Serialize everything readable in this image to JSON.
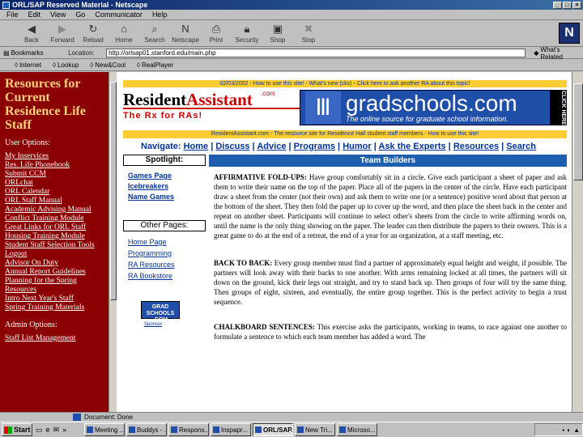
{
  "window": {
    "title": "ORL/SAP Reserved Material - Netscape",
    "controls": [
      "_",
      "□",
      "×"
    ]
  },
  "menu": [
    "File",
    "Edit",
    "View",
    "Go",
    "Communicator",
    "Help"
  ],
  "toolbar": [
    {
      "label": "Back",
      "icon": "back-arrow-icon"
    },
    {
      "label": "Forward",
      "icon": "forward-arrow-icon"
    },
    {
      "label": "Reload",
      "icon": "reload-icon"
    },
    {
      "label": "Home",
      "icon": "home-icon"
    },
    {
      "label": "Search",
      "icon": "search-icon"
    },
    {
      "label": "Netscape",
      "icon": "netscape-icon"
    },
    {
      "label": "Print",
      "icon": "print-icon"
    },
    {
      "label": "Security",
      "icon": "lock-icon"
    },
    {
      "label": "Shop",
      "icon": "shop-icon"
    },
    {
      "label": "Stop",
      "icon": "stop-icon"
    }
  ],
  "location": {
    "bookmarks_label": "Bookmarks",
    "location_label": "Location:",
    "url": "http://orlsap01.stanford.edu/main.php",
    "related_label": "What's Related"
  },
  "personal_toolbar": [
    "Internet",
    "Lookup",
    "New&Cool",
    "RealPlayer"
  ],
  "left_frame": {
    "title": "Resources for Current Residence Life Staff",
    "user_options_label": "User Options:",
    "links": [
      "My Inservices",
      "Res. Life Phonebook",
      "Submit CCM",
      "ORLchat",
      "ORL Calendar",
      "ORL Staff Manual",
      "Academic Advising Manual",
      "Conflict Training Module",
      "Great Links for ORL Staff",
      "Housing Training Module",
      "Student Staff Selection Tools",
      "Logout",
      "Advisor On Duty",
      "Annual Report Guidelines",
      "Planning for the Spring",
      "Resources",
      "Intro Next Year's Staff",
      "Spring Training Materials"
    ],
    "admin_options_label": "Admin Options:",
    "admin_links": [
      "Staff List Management"
    ]
  },
  "main_frame": {
    "top_notice": "02/03/2002 - How to use this site! - What's new (cks) - Click here to ask another RA about this topic!",
    "ra_logo": {
      "word1": "Resident",
      "word2": "Assistant",
      "dotcom": ".com",
      "tagline": "The Rx for RAs!"
    },
    "grad_banner": {
      "pillar": "Ⅲ",
      "title": "gradschools.com",
      "subtitle": "The online source for graduate school information.",
      "click": "CLICK HERE"
    },
    "ra_line": "ResidentAssistant.com - The resource site for Residence Hall student staff members - How to use this site!",
    "nav_label": "Navigate:",
    "nav": [
      "Home",
      "Discuss",
      "Advice",
      "Programs",
      "Humor",
      "Ask the Experts",
      "Resources",
      "Search"
    ],
    "spotlight_label": "Spotlight:",
    "spotlight_links": [
      "Games Page",
      "Icebreakers",
      "Name Games"
    ],
    "other_label": "Other Pages:",
    "other_links": [
      "Home Page",
      "Programming",
      "RA Resources",
      "RA Bookstore"
    ],
    "grad_small": "GRAD SCHOOLS .COM",
    "sponsor": "Sponsor",
    "section_header": "Team Builders",
    "articles": [
      {
        "title": "AFFIRMATIVE FOLD-UPS:",
        "body": "Have group comfortably sit in a circle. Give each participant a sheet of paper and ask them to write their name on the top of the paper. Place all of the papers in the center of the circle. Have each participant draw a sheet from the center (not their own) and ask them to write one (or a sentence) positive word about that person at the bottom of the sheet. They then fold the paper up to cover up the word, and then place the sheet back in the center and repeat on another sheet. Participants will continue to select other's sheets from the circle to write affirming words on, until the name is the only thing showing on the paper. The leader can then distribute the papers to their owners. This is a great game to do at the end of a retreat, the end of a year for an organization, at a staff meeting, etc."
      },
      {
        "title": "BACK TO BACK:",
        "body": "Every group member must find a partner of approximately equal height and weight, if possible. The partners will look away with their backs to one another. With arms remaining locked at all times, the partners will sit down on the ground, kick their legs out straight, and try to stand back up. Then groups of four will try the same thing. Then groups of eight, sixteen, and eventually, the entire group together. This is the perfect activity to begin a trust sequence."
      },
      {
        "title": "CHALKBOARD SENTENCES:",
        "body": "This exercise asks the participants, working in teams, to race against one another to formulate a sentence to which each team member has added a word. The"
      }
    ]
  },
  "status": {
    "text": "Document: Done"
  },
  "taskbar": {
    "start": "Start",
    "tasks": [
      "Meeting ...",
      "Buddys - ...",
      "Respons...",
      "Inspapr...",
      "ORL/SAP...",
      "New Tri...",
      "Microso..."
    ],
    "active_index": 4
  }
}
